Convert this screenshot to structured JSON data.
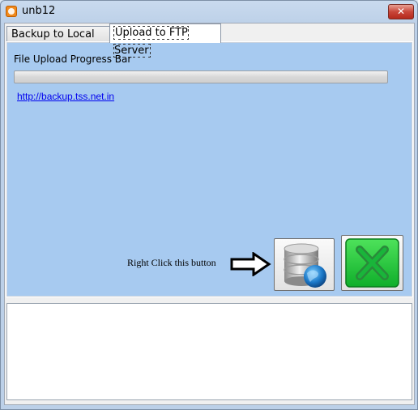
{
  "window": {
    "title": "unb12",
    "close_label": "✕"
  },
  "tabs": [
    {
      "label": "Backup to Local Disk",
      "active": false
    },
    {
      "label": "Upload to FTP Server",
      "active": true
    }
  ],
  "panel": {
    "progress_label": "File Upload Progress Bar",
    "progress_value": 0,
    "link_text": "http://backup.tss.net.in",
    "hint_text": "Right Click this button"
  },
  "colors": {
    "panel_bg": "#a7caf0",
    "exit_green": "#21c23a",
    "link": "#0000ee"
  },
  "icons": {
    "database": "database-globe-icon",
    "exit": "exit-x-icon",
    "arrow": "arrow-right-icon"
  }
}
